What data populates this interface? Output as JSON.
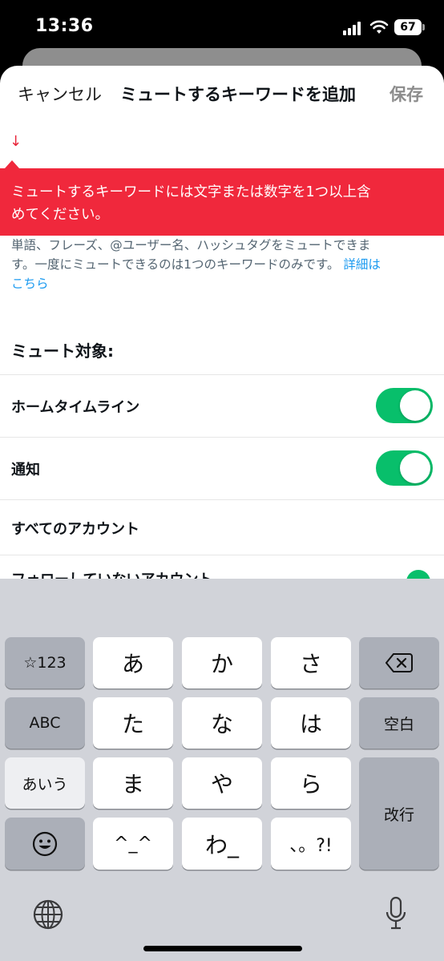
{
  "status_bar": {
    "time": "13:36",
    "battery": "67"
  },
  "nav": {
    "cancel_label": "キャンセル",
    "title": "ミュートするキーワードを追加",
    "save_label": "保存"
  },
  "input": {
    "value": "",
    "arrow_glyph": "↓"
  },
  "error": {
    "line1": "ミュートするキーワードには文字または数字を1つ以上含",
    "line2": "めてください。"
  },
  "description": {
    "line1": "単語、フレーズ、@ユーザー名、ハッシュタグをミュートできま",
    "line2_text": "す。一度にミュートできるのは1つのキーワードのみです。",
    "link_part1": "詳細は",
    "link_part2": "こちら"
  },
  "mute_section": {
    "header": "ミュート対象:",
    "rows": [
      {
        "label": "ホームタイムライン",
        "toggle_on": true
      },
      {
        "label": "通知",
        "toggle_on": true
      },
      {
        "label": "すべてのアカウント"
      }
    ],
    "partial_row_label": "フォローしていないアカウント"
  },
  "keyboard": {
    "keys": {
      "symbols": "☆123",
      "abc": "ABC",
      "kana": "あいう",
      "a": "あ",
      "ka": "か",
      "sa": "さ",
      "ta": "た",
      "na": "な",
      "ha": "は",
      "ma": "ま",
      "ya": "や",
      "ra": "ら",
      "emoticon": "^_^",
      "wa": "わ_",
      "punct": "、。?!",
      "space": "空白",
      "return": "改行"
    }
  },
  "colors": {
    "error_red": "#f0283c",
    "toggle_green": "#08bf6b",
    "link_blue": "#1d9bf0"
  }
}
